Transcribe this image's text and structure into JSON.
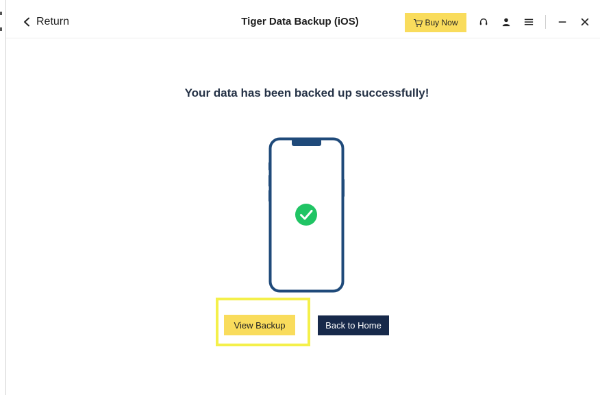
{
  "titlebar": {
    "return_label": "Return",
    "app_title": "Tiger Data Backup (iOS)",
    "buy_label": "Buy Now",
    "icons": [
      "headset-icon",
      "user-icon",
      "menu-icon",
      "minimize-icon",
      "close-icon"
    ]
  },
  "main": {
    "headline": "Your data has been backed up successfully!",
    "view_backup_label": "View Backup",
    "back_home_label": "Back to Home"
  },
  "colors": {
    "accent_yellow": "#f9dc5c",
    "navy": "#17294a",
    "phone_outline": "#1f4a7a",
    "success_green": "#20c464",
    "highlight": "#f4f04a"
  }
}
